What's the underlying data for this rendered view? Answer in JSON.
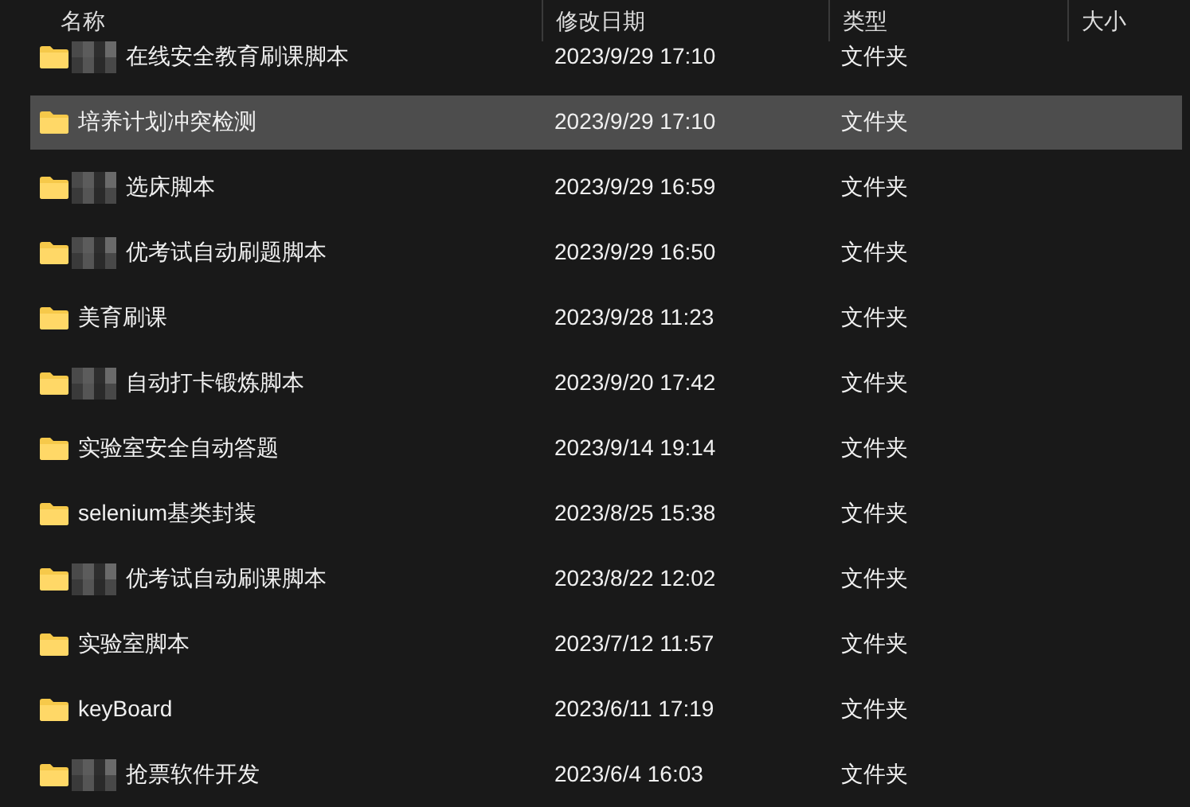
{
  "columns": [
    "名称",
    "修改日期",
    "类型",
    "大小"
  ],
  "rows": [
    {
      "name": "在线安全教育刷课脚本",
      "date": "2023/9/29 17:10",
      "type": "文件夹",
      "selected": false,
      "redacted": true
    },
    {
      "name": "培养计划冲突检测",
      "date": "2023/9/29 17:10",
      "type": "文件夹",
      "selected": true,
      "redacted": false
    },
    {
      "name": "选床脚本",
      "date": "2023/9/29 16:59",
      "type": "文件夹",
      "selected": false,
      "redacted": true
    },
    {
      "name": "优考试自动刷题脚本",
      "date": "2023/9/29 16:50",
      "type": "文件夹",
      "selected": false,
      "redacted": true
    },
    {
      "name": "美育刷课",
      "date": "2023/9/28 11:23",
      "type": "文件夹",
      "selected": false,
      "redacted": false
    },
    {
      "name": "自动打卡锻炼脚本",
      "date": "2023/9/20 17:42",
      "type": "文件夹",
      "selected": false,
      "redacted": true
    },
    {
      "name": "实验室安全自动答题",
      "date": "2023/9/14 19:14",
      "type": "文件夹",
      "selected": false,
      "redacted": false
    },
    {
      "name": "selenium基类封装",
      "date": "2023/8/25 15:38",
      "type": "文件夹",
      "selected": false,
      "redacted": false
    },
    {
      "name": "优考试自动刷课脚本",
      "date": "2023/8/22 12:02",
      "type": "文件夹",
      "selected": false,
      "redacted": true
    },
    {
      "name": "实验室脚本",
      "date": "2023/7/12 11:57",
      "type": "文件夹",
      "selected": false,
      "redacted": false
    },
    {
      "name": "keyBoard",
      "date": "2023/6/11 17:19",
      "type": "文件夹",
      "selected": false,
      "redacted": false
    },
    {
      "name": "抢票软件开发",
      "date": "2023/6/4 16:03",
      "type": "文件夹",
      "selected": false,
      "redacted": true
    }
  ]
}
